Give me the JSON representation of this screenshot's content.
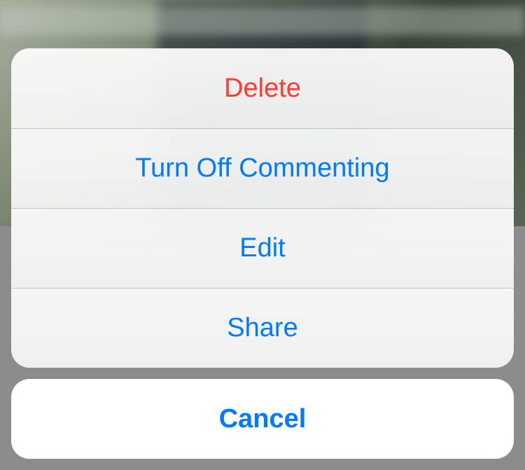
{
  "actionSheet": {
    "options": [
      {
        "label": "Delete",
        "destructive": true
      },
      {
        "label": "Turn Off Commenting",
        "destructive": false
      },
      {
        "label": "Edit",
        "destructive": false
      },
      {
        "label": "Share",
        "destructive": false
      }
    ],
    "cancel": {
      "label": "Cancel"
    }
  },
  "colors": {
    "accent": "#007aff",
    "destructive": "#ff3b30"
  }
}
